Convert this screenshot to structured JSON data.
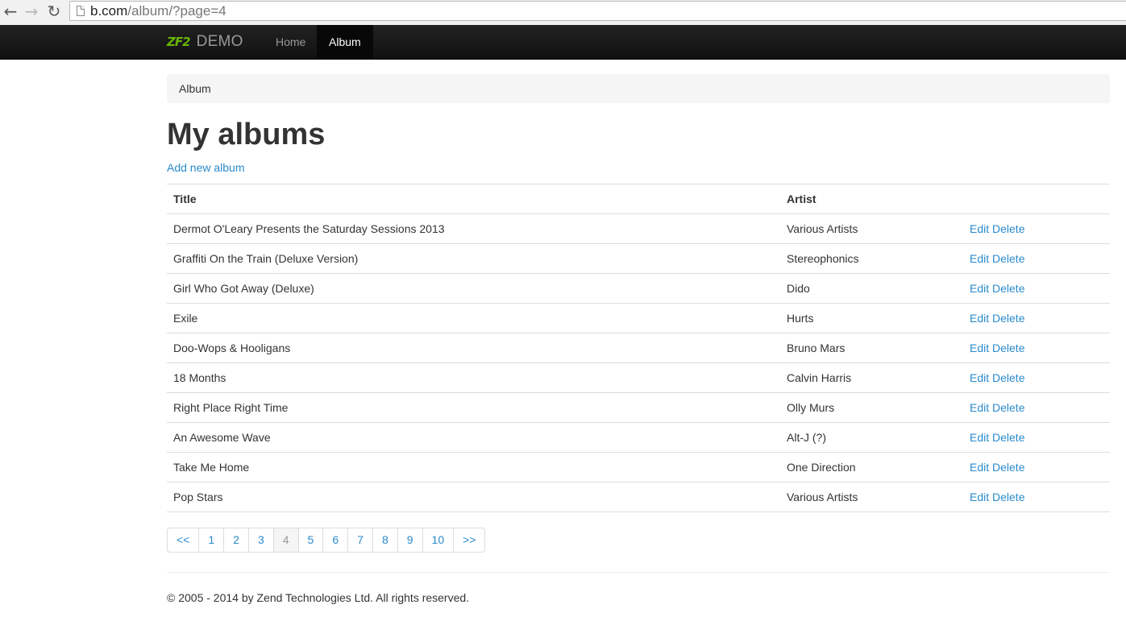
{
  "browser": {
    "url_main": "b.com",
    "url_path": "/album/?page=4",
    "back_icon": "back-arrow-icon",
    "forward_icon": "forward-arrow-icon",
    "reload_icon": "reload-icon"
  },
  "navbar": {
    "logo_text": "ZF2",
    "brand": "DEMO",
    "items": [
      {
        "label": "Home",
        "active": false
      },
      {
        "label": "Album",
        "active": true
      }
    ]
  },
  "breadcrumb": "Album",
  "page_title": "My albums",
  "add_link": "Add new album",
  "table": {
    "headers": [
      "Title",
      "Artist",
      ""
    ],
    "edit_label": "Edit",
    "delete_label": "Delete",
    "rows": [
      {
        "title": "Dermot O'Leary Presents the Saturday Sessions 2013",
        "artist": "Various Artists"
      },
      {
        "title": "Graffiti On the Train (Deluxe Version)",
        "artist": "Stereophonics"
      },
      {
        "title": "Girl Who Got Away (Deluxe)",
        "artist": "Dido"
      },
      {
        "title": "Exile",
        "artist": "Hurts"
      },
      {
        "title": "Doo-Wops & Hooligans",
        "artist": "Bruno Mars"
      },
      {
        "title": "18 Months",
        "artist": "Calvin Harris"
      },
      {
        "title": "Right Place Right Time",
        "artist": "Olly Murs"
      },
      {
        "title": "An Awesome Wave",
        "artist": "Alt-J (?)"
      },
      {
        "title": "Take Me Home",
        "artist": "One Direction"
      },
      {
        "title": "Pop Stars",
        "artist": "Various Artists"
      }
    ]
  },
  "pagination": {
    "first": "<<",
    "pages": [
      "1",
      "2",
      "3",
      "4",
      "5",
      "6",
      "7",
      "8",
      "9",
      "10"
    ],
    "current": "4",
    "last": ">>"
  },
  "footer": "© 2005 - 2014 by Zend Technologies Ltd. All rights reserved.",
  "colors": {
    "link": "#2a8bcc",
    "navbar": "#111111",
    "logo": "#68b604"
  }
}
